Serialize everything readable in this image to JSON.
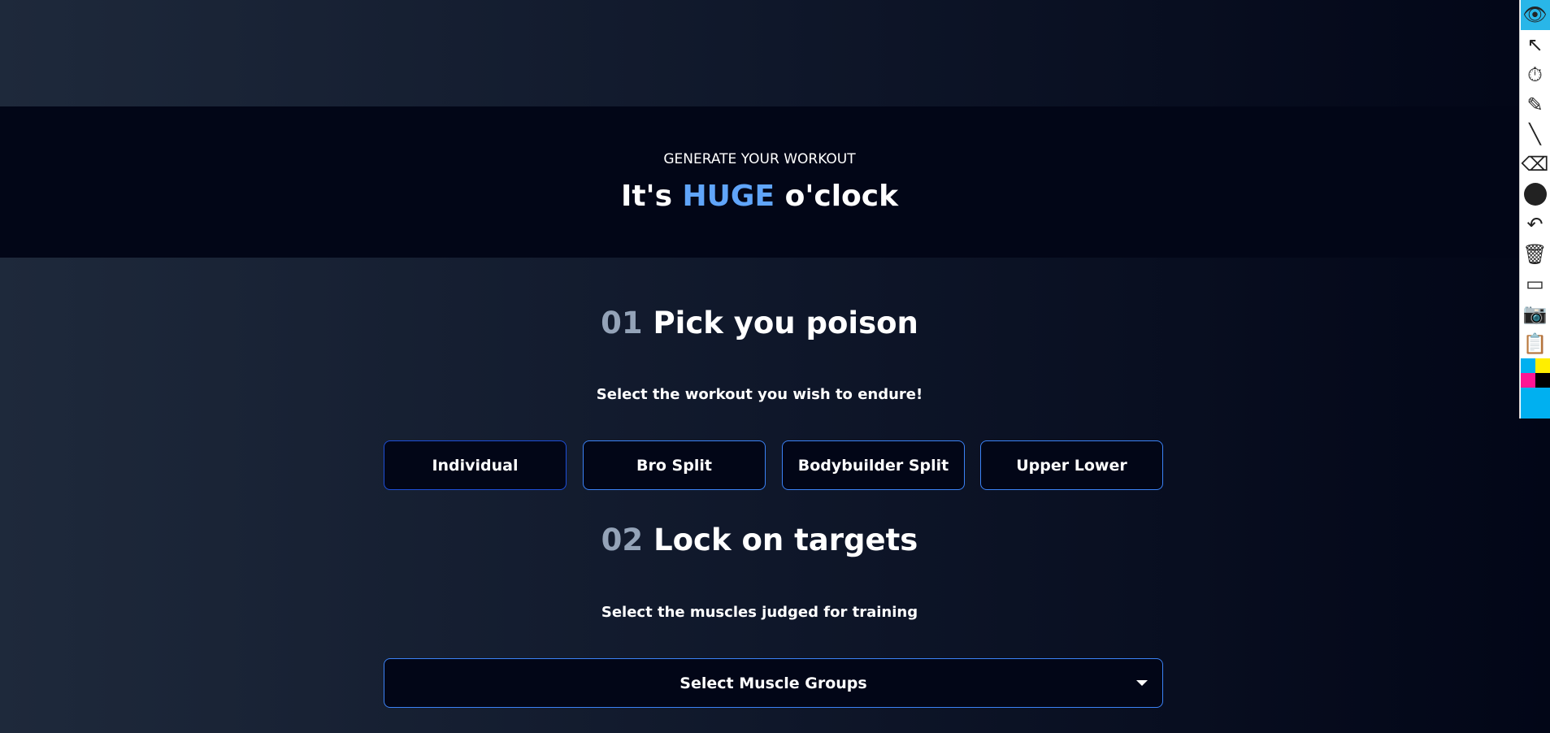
{
  "header": {
    "eyebrow": "GENERATE YOUR WORKOUT",
    "title_pre": "It's ",
    "title_highlight": "HUGE",
    "title_post": " o'clock",
    "highlight_color": "#60a5fa"
  },
  "step1": {
    "number": "01",
    "title": "Pick you poison",
    "subtitle": "Select the workout you wish to endure!",
    "options": [
      "Individual",
      "Bro Split",
      "Bodybuilder Split",
      "Upper Lower"
    ],
    "selected": "Individual"
  },
  "step2": {
    "number": "02",
    "title": "Lock on targets",
    "subtitle": "Select the muscles judged for training",
    "select_placeholder": "Select Muscle Groups"
  },
  "toolbar": {
    "icons": [
      "eye-icon",
      "cursor-icon",
      "timer-off-icon",
      "pencil-icon",
      "line-icon",
      "eraser-icon",
      "circle-icon",
      "undo-icon",
      "trash-icon",
      "board-icon",
      "camera-icon",
      "clipboard-icon"
    ],
    "palette": [
      "#00b0f0",
      "#ffee00",
      "#ff1493",
      "#000000"
    ]
  }
}
